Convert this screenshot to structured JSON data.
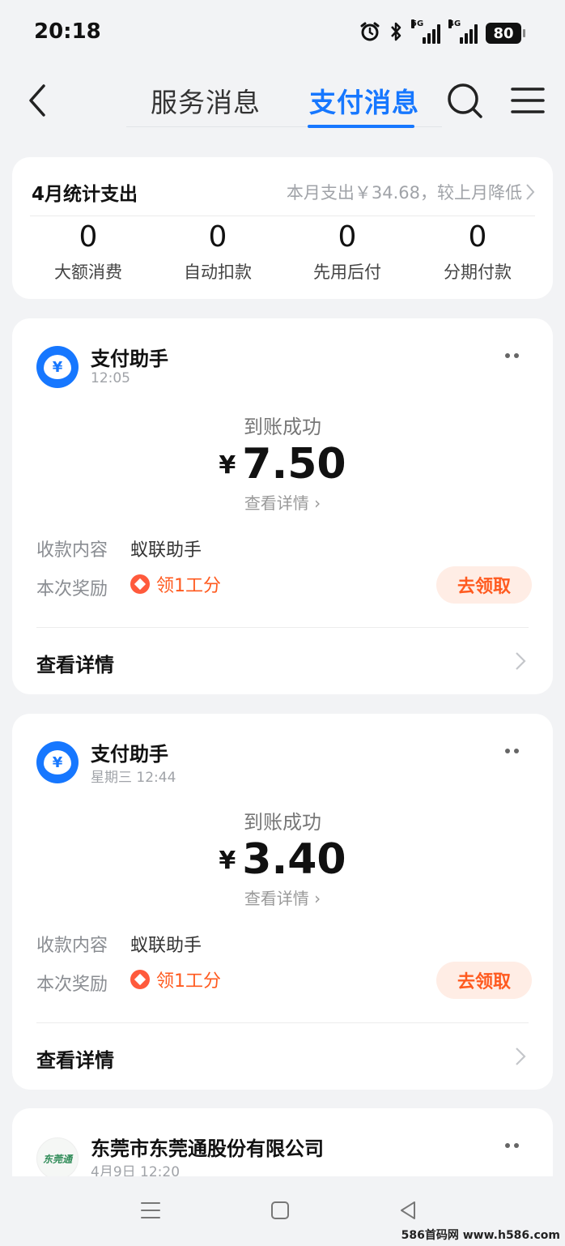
{
  "status_bar": {
    "time": "20:18",
    "battery": "80",
    "net1": "5G",
    "net2": "4G"
  },
  "nav": {
    "tabs": [
      "服务消息",
      "支付消息"
    ],
    "active_tab": "支付消息"
  },
  "stats": {
    "title": "4月统计支出",
    "summary": "本月支出￥34.68，较上月降低",
    "items": [
      {
        "value": "0",
        "label": "大额消费"
      },
      {
        "value": "0",
        "label": "自动扣款"
      },
      {
        "value": "0",
        "label": "先用后付"
      },
      {
        "value": "0",
        "label": "分期付款"
      }
    ]
  },
  "messages": [
    {
      "sender": "支付助手",
      "time": "12:05",
      "status": "到账成功",
      "currency": "¥",
      "amount": "7.50",
      "detail_link": "查看详情",
      "content_label": "收款内容",
      "content_value": "蚁联助手",
      "reward_label": "本次奖励",
      "reward_text": "领1工分",
      "claim_button": "去领取",
      "footer": "查看详情"
    },
    {
      "sender": "支付助手",
      "time": "星期三 12:44",
      "status": "到账成功",
      "currency": "¥",
      "amount": "3.40",
      "detail_link": "查看详情",
      "content_label": "收款内容",
      "content_value": "蚁联助手",
      "reward_label": "本次奖励",
      "reward_text": "领1工分",
      "claim_button": "去领取",
      "footer": "查看详情"
    },
    {
      "sender": "东莞市东莞通股份有限公司",
      "time": "4月9日 12:20",
      "logo_text": "东莞通"
    }
  ],
  "watermark": "586首码网 www.h586.com",
  "colors": {
    "accent": "#1677ff",
    "reward": "#ff5a1f",
    "background": "#f2f3f5"
  }
}
